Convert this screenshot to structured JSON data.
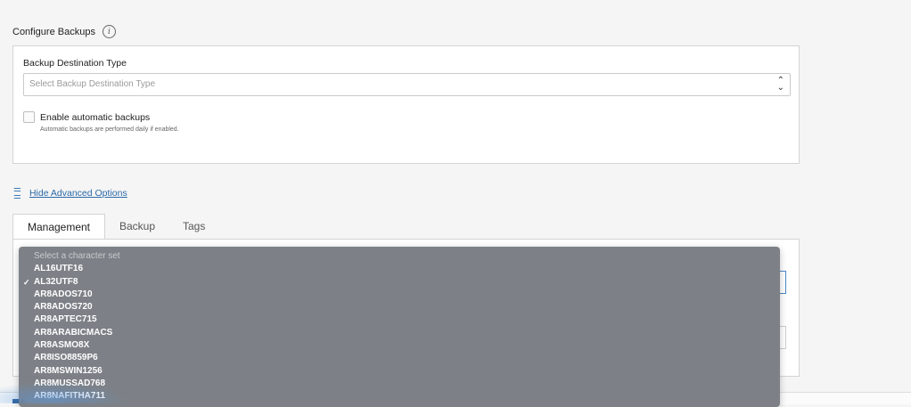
{
  "section": {
    "title": "Configure Backups",
    "info_icon": "i"
  },
  "backup": {
    "destination_label": "Backup Destination Type",
    "destination_placeholder": "Select Backup Destination Type",
    "updown_icon": "⌃⌄",
    "auto_label": "Enable automatic backups",
    "auto_help": "Automatic backups are performed daily if enabled."
  },
  "advanced": {
    "link_label": "Hide Advanced Options",
    "icon": "sliders-icon"
  },
  "tabs": [
    {
      "label": "Management",
      "active": true
    },
    {
      "label": "Backup",
      "active": false
    },
    {
      "label": "Tags",
      "active": false
    }
  ],
  "charset_dropdown": {
    "placeholder": "Select a character set",
    "selected": "AL32UTF8",
    "check_mark": "✓",
    "options": [
      "AL16UTF16",
      "AL32UTF8",
      "AR8ADOS710",
      "AR8ADOS720",
      "AR8APTEC715",
      "AR8ARABICMACS",
      "AR8ASMO8X",
      "AR8ISO8859P6",
      "AR8MSWIN1256",
      "AR8MUSSAD768",
      "AR8NAFITHA711"
    ]
  },
  "colors": {
    "link": "#2b6aa8",
    "dropdown_bg": "#787c82",
    "focus_border": "#4a88c8"
  }
}
